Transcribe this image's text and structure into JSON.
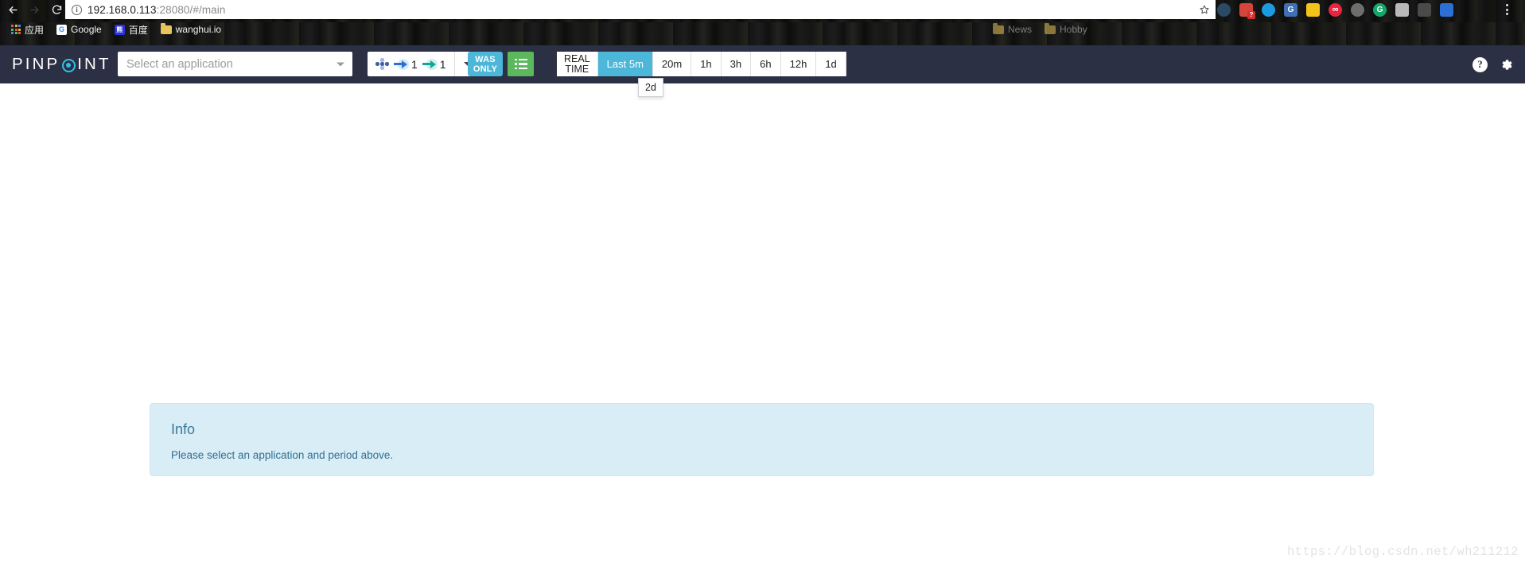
{
  "browser": {
    "nav": {
      "back_icon": "back-arrow-icon",
      "forward_icon": "forward-arrow-icon",
      "reload_icon": "reload-icon"
    },
    "url": {
      "host": "192.168.0.113",
      "rest": ":28080/#/main",
      "full": "192.168.0.113:28080/#/main",
      "info_glyph": "i"
    },
    "star_icon": "bookmark-star-icon",
    "menu_icon": "kebab-menu-icon",
    "bookmarks": [
      {
        "label": "应用",
        "icon": "apps-grid-icon"
      },
      {
        "label": "Google",
        "icon": "google-icon",
        "letter": "G",
        "color": "#ffffff"
      },
      {
        "label": "百度",
        "icon": "baidu-icon",
        "letter": "熊",
        "color": "#2932e1"
      },
      {
        "label": "wanghui.io",
        "icon": "folder-icon"
      }
    ],
    "bookmarks_far": [
      {
        "label": "News",
        "icon": "folder-icon"
      },
      {
        "label": "Hobby",
        "icon": "folder-icon"
      }
    ],
    "extensions": [
      {
        "name": "chat-extension",
        "color": "#2a4a66",
        "round": true,
        "glyph": ""
      },
      {
        "name": "feedly-extension",
        "color": "#d5453b",
        "round": false,
        "glyph": "",
        "badge": "?"
      },
      {
        "name": "vimeo-extension",
        "color": "#1b9be0",
        "round": true,
        "glyph": ""
      },
      {
        "name": "google-docs-extension",
        "color": "#3f6fb5",
        "round": false,
        "glyph": "G"
      },
      {
        "name": "dots-extension",
        "color": "#f2c31b",
        "round": false,
        "glyph": ""
      },
      {
        "name": "infinity-extension",
        "color": "#e8243f",
        "round": true,
        "glyph": "∞"
      },
      {
        "name": "lock-extension",
        "color": "#6e6e6e",
        "round": true,
        "glyph": ""
      },
      {
        "name": "grammarly-extension",
        "color": "#15a66a",
        "round": true,
        "glyph": "G"
      },
      {
        "name": "simplenote-extension",
        "color": "#b9b9b9",
        "round": false,
        "glyph": ""
      },
      {
        "name": "evernote-extension",
        "color": "#4a4a4a",
        "round": false,
        "glyph": ""
      },
      {
        "name": "diamond-extension",
        "color": "#2c6fd6",
        "round": false,
        "glyph": ""
      }
    ]
  },
  "app": {
    "brand": {
      "text_before": "PINP",
      "text_after": "INT",
      "accent": "#33bde4"
    },
    "application_select": {
      "placeholder": "Select an application",
      "value": "",
      "caret_icon": "chevron-down-icon"
    },
    "depth": {
      "node_icon": "node-dots-icon",
      "inbound_icon": "inbound-arrow-icon",
      "inbound_value": "1",
      "outbound_icon": "outbound-arrow-icon",
      "outbound_value": "1",
      "caret_icon": "chevron-down-icon"
    },
    "was_only": {
      "line1": "WAS",
      "line2": "ONLY"
    },
    "list_button": {
      "icon": "list-view-icon"
    },
    "periods": [
      {
        "label": "REAL TIME",
        "line1": "REAL",
        "line2": "TIME",
        "active": false,
        "realtime": true
      },
      {
        "label": "Last 5m",
        "active": true
      },
      {
        "label": "20m",
        "active": false
      },
      {
        "label": "1h",
        "active": false
      },
      {
        "label": "3h",
        "active": false
      },
      {
        "label": "6h",
        "active": false
      },
      {
        "label": "12h",
        "active": false
      },
      {
        "label": "1d",
        "active": false
      }
    ],
    "period_dropdown": {
      "label": "2d"
    },
    "header_right": {
      "help_icon": "help-question-icon",
      "help_glyph": "?",
      "settings_icon": "gear-icon"
    }
  },
  "main": {
    "info": {
      "title": "Info",
      "message": "Please select an application and period above."
    }
  },
  "watermark": "https://blog.csdn.net/wh211212",
  "colors": {
    "header_bg": "#2b3044",
    "accent_cyan": "#4cb7d9",
    "accent_green": "#5cb85c",
    "info_bg": "#d9edf7",
    "info_text": "#31708f"
  }
}
